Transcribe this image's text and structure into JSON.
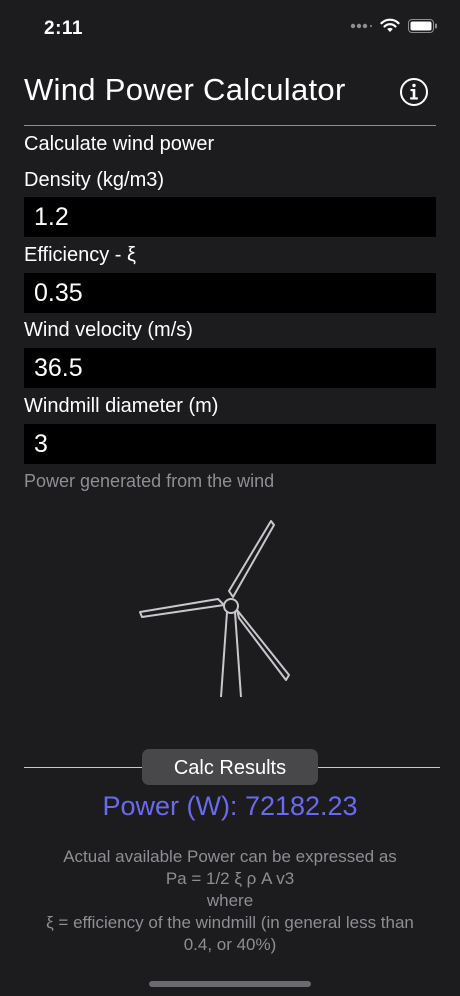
{
  "status_bar": {
    "time": "2:11"
  },
  "nav": {
    "title": "Wind Power Calculator",
    "info_icon": "info-icon"
  },
  "form": {
    "section_label": "Calculate wind power",
    "density_label": "Density (kg/m3)",
    "density_value": "1.2",
    "efficiency_label": "Efficiency - ξ",
    "efficiency_value": "0.35",
    "velocity_label": "Wind velocity (m/s)",
    "velocity_value": "36.5",
    "diameter_label": "Windmill diameter (m)",
    "diameter_value": "3",
    "caption": "Power generated from the wind"
  },
  "results": {
    "button_label": "Calc Results",
    "power_text": "Power (W): 72182.23"
  },
  "explanation": {
    "line1": "Actual available Power can be expressed as",
    "line2": "Pa = 1/2 ξ ρ A v3",
    "line3": "where",
    "line4": "ξ = efficiency of the windmill (in general less than 0.4, or 40%)"
  },
  "colors": {
    "background": "#1c1c1e",
    "accent": "#6a6af0",
    "field": "#000000"
  }
}
